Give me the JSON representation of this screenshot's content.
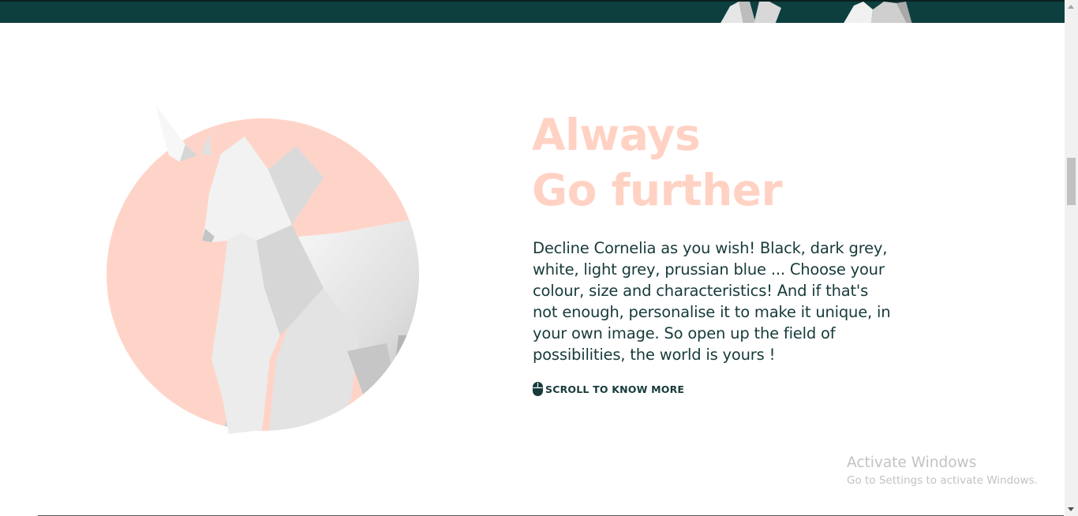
{
  "hero": {
    "title_line1": "Always",
    "title_line2": "Go further",
    "description": "Decline Cornelia as you wish! Black, dark grey, white, light grey, prussian blue ... Choose your colour, size and characteristics! And if that's not enough, personalise it to make it unique, in your own image. So open up the field of possibilities, the world is yours !",
    "scroll_label": "SCROLL TO KNOW MORE",
    "scroll_icon": "mouse-icon",
    "image_subject": "low-poly-unicorn"
  },
  "watermark": {
    "title": "Activate Windows",
    "subtitle": "Go to Settings to activate Windows."
  },
  "colors": {
    "accent_peach": "#ffd2c4",
    "dark_teal": "#0d3f3f",
    "text_dark": "#173a3a"
  }
}
